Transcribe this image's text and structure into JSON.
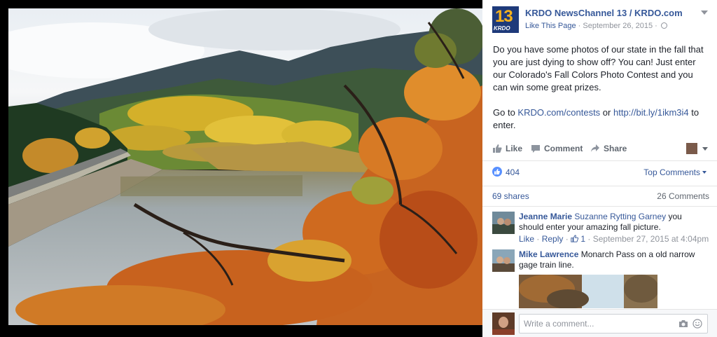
{
  "post": {
    "page_name": "KRDO NewsChannel 13 / KRDO.com",
    "logo_number": "13",
    "logo_brand": "KRDO",
    "like_page": "Like This Page",
    "separator": "·",
    "date": "September 26, 2015",
    "text_p1": "Do you have some photos of our state in the fall that you are just dying to show off? You can! Just enter our Colorado's Fall Colors Photo Contest and you can win some great prizes.",
    "text_p2_pre": "Go to ",
    "link1": "KRDO.com/contests",
    "text_p2_mid": " or ",
    "link2": "http://bit.ly/1ikm3i4",
    "text_p2_post": " to enter."
  },
  "actions": {
    "like": "Like",
    "comment": "Comment",
    "share": "Share"
  },
  "stats": {
    "likes": "404",
    "top_comments": "Top Comments",
    "shares": "69 shares",
    "comments": "26 Comments"
  },
  "comments": [
    {
      "author": "Jeanne Marie",
      "mention": "Suzanne Rytting Garney",
      "text": " you should enter your amazing fall picture.",
      "like": "Like",
      "reply": "Reply",
      "likes": "1",
      "date": "September 27, 2015 at 4:04pm"
    },
    {
      "author": "Mike Lawrence",
      "text": " Monarch Pass on a old narrow gage train line."
    }
  ],
  "compose": {
    "placeholder": "Write a comment..."
  },
  "colors": {
    "link": "#365899",
    "like_badge": "#5890ff",
    "logo_bg": "#1e3a7a",
    "logo_num": "#f7b21b"
  }
}
